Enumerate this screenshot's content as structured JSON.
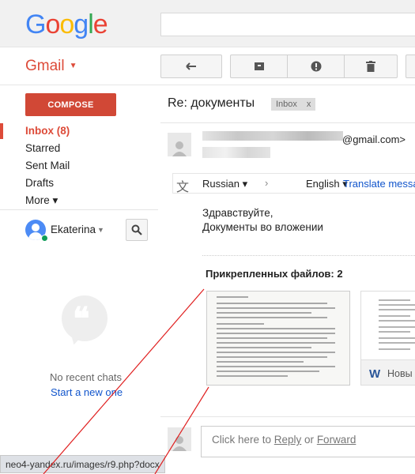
{
  "header": {
    "logo_letters": [
      {
        "ch": "G",
        "color": "#4285f4"
      },
      {
        "ch": "o",
        "color": "#ea4335"
      },
      {
        "ch": "o",
        "color": "#fbbc05"
      },
      {
        "ch": "g",
        "color": "#4285f4"
      },
      {
        "ch": "l",
        "color": "#34a853"
      },
      {
        "ch": "e",
        "color": "#ea4335"
      }
    ]
  },
  "app": {
    "label": "Gmail"
  },
  "toolbar": {
    "icons": [
      "reply-icon",
      "archive-icon",
      "report-spam-icon",
      "trash-icon"
    ]
  },
  "sidebar": {
    "compose_label": "COMPOSE",
    "items": [
      {
        "label": "Inbox (8)",
        "active": true
      },
      {
        "label": "Starred"
      },
      {
        "label": "Sent Mail"
      },
      {
        "label": "Drafts"
      },
      {
        "label": "More ▾"
      }
    ],
    "user_name": "Ekaterina",
    "chat_quote_glyph": "❝",
    "no_chats": "No recent chats",
    "start_chat": "Start a new one"
  },
  "message": {
    "subject": "Re: документы",
    "label": "Inbox",
    "label_close": "x",
    "sender_email_suffix": "@gmail.com>",
    "translate": {
      "from": "Russian ▾",
      "arrow": "›",
      "to": "English ▾",
      "action": "Translate messa"
    },
    "body_lines": [
      "Здравствуйте,",
      "Документы во вложении"
    ],
    "attachments_title": "Прикрепленных файлов: 2",
    "attachment2_name": "Новы",
    "attachment2_icon": "W"
  },
  "reply": {
    "prefix": "Click here to ",
    "reply_link": "Reply",
    "or": " or ",
    "forward_link": "Forward"
  },
  "statusbar": {
    "url": "neo4-yandex.ru/images/r9.php?docx"
  },
  "colors": {
    "accent": "#dd4b39",
    "link": "#1155cc",
    "annotation": "#e02020"
  }
}
